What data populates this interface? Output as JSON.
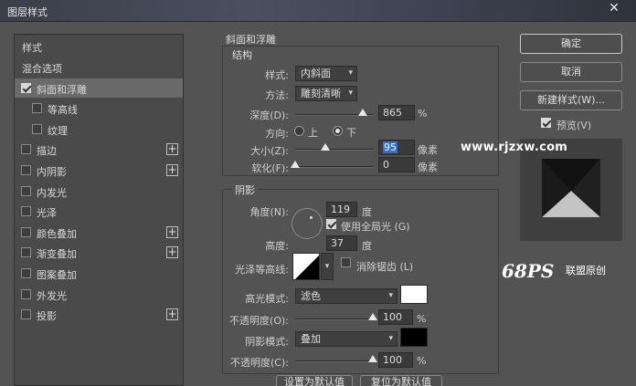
{
  "window": {
    "title": "图层样式",
    "close_glyph": "✕"
  },
  "style_list": {
    "header": "样式",
    "items": [
      {
        "label": "混合选项",
        "checkbox": false,
        "checked": false,
        "plus": false,
        "indent": 0,
        "active": false
      },
      {
        "label": "斜面和浮雕",
        "checkbox": true,
        "checked": true,
        "plus": false,
        "indent": 0,
        "active": true
      },
      {
        "label": "等高线",
        "checkbox": true,
        "checked": false,
        "plus": false,
        "indent": 1,
        "active": false
      },
      {
        "label": "纹理",
        "checkbox": true,
        "checked": false,
        "plus": false,
        "indent": 1,
        "active": false
      },
      {
        "label": "描边",
        "checkbox": true,
        "checked": false,
        "plus": true,
        "indent": 0,
        "active": false
      },
      {
        "label": "内阴影",
        "checkbox": true,
        "checked": false,
        "plus": true,
        "indent": 0,
        "active": false
      },
      {
        "label": "内发光",
        "checkbox": true,
        "checked": false,
        "plus": false,
        "indent": 0,
        "active": false
      },
      {
        "label": "光泽",
        "checkbox": true,
        "checked": false,
        "plus": false,
        "indent": 0,
        "active": false
      },
      {
        "label": "颜色叠加",
        "checkbox": true,
        "checked": false,
        "plus": true,
        "indent": 0,
        "active": false
      },
      {
        "label": "渐变叠加",
        "checkbox": true,
        "checked": false,
        "plus": true,
        "indent": 0,
        "active": false
      },
      {
        "label": "图案叠加",
        "checkbox": true,
        "checked": false,
        "plus": false,
        "indent": 0,
        "active": false
      },
      {
        "label": "外发光",
        "checkbox": true,
        "checked": false,
        "plus": false,
        "indent": 0,
        "active": false
      },
      {
        "label": "投影",
        "checkbox": true,
        "checked": false,
        "plus": true,
        "indent": 0,
        "active": false
      }
    ]
  },
  "bevel": {
    "section_title": "斜面和浮雕",
    "structure_title": "结构",
    "style_label": "样式:",
    "style_value": "内斜面",
    "technique_label": "方法:",
    "technique_value": "雕刻清晰",
    "depth_label": "深度(D):",
    "depth_value": "865",
    "depth_unit": "%",
    "depth_fraction": 0.865,
    "direction_label": "方向:",
    "direction_up": "上",
    "direction_down": "下",
    "size_label": "大小(Z):",
    "size_value": "95",
    "size_unit": "像素",
    "size_fraction": 0.38,
    "soften_label": "软化(F):",
    "soften_value": "0",
    "soften_unit": "像素",
    "soften_fraction": 0.0
  },
  "shading": {
    "title": "阴影",
    "angle_label": "角度(N):",
    "angle_value": "119",
    "angle_unit": "度",
    "global_light_label": "使用全局光 (G)",
    "global_light_checked": true,
    "altitude_label": "高度:",
    "altitude_value": "37",
    "altitude_unit": "度",
    "gloss_label": "光泽等高线:",
    "antialias_label": "消除锯齿 (L)",
    "highlight_mode_label": "高光模式:",
    "highlight_mode_value": "滤色",
    "highlight_color": "#ffffff",
    "highlight_opacity_label": "不透明度(O):",
    "highlight_opacity_value": "100",
    "highlight_opacity_unit": "%",
    "shadow_mode_label": "阴影模式:",
    "shadow_mode_value": "叠加",
    "shadow_color": "#000000",
    "shadow_opacity_label": "不透明度(C):",
    "shadow_opacity_value": "100",
    "shadow_opacity_unit": "%"
  },
  "buttons": {
    "ok": "确定",
    "cancel": "取消",
    "new_style": "新建样式(W)...",
    "preview_label": "预览(V)",
    "preview_checked": true,
    "set_default": "设置为默认值",
    "reset_default": "复位为默认值"
  },
  "watermark": {
    "site": "www.rjzxw.com",
    "logo": "68PS",
    "logo_sub": "联盟原创"
  }
}
